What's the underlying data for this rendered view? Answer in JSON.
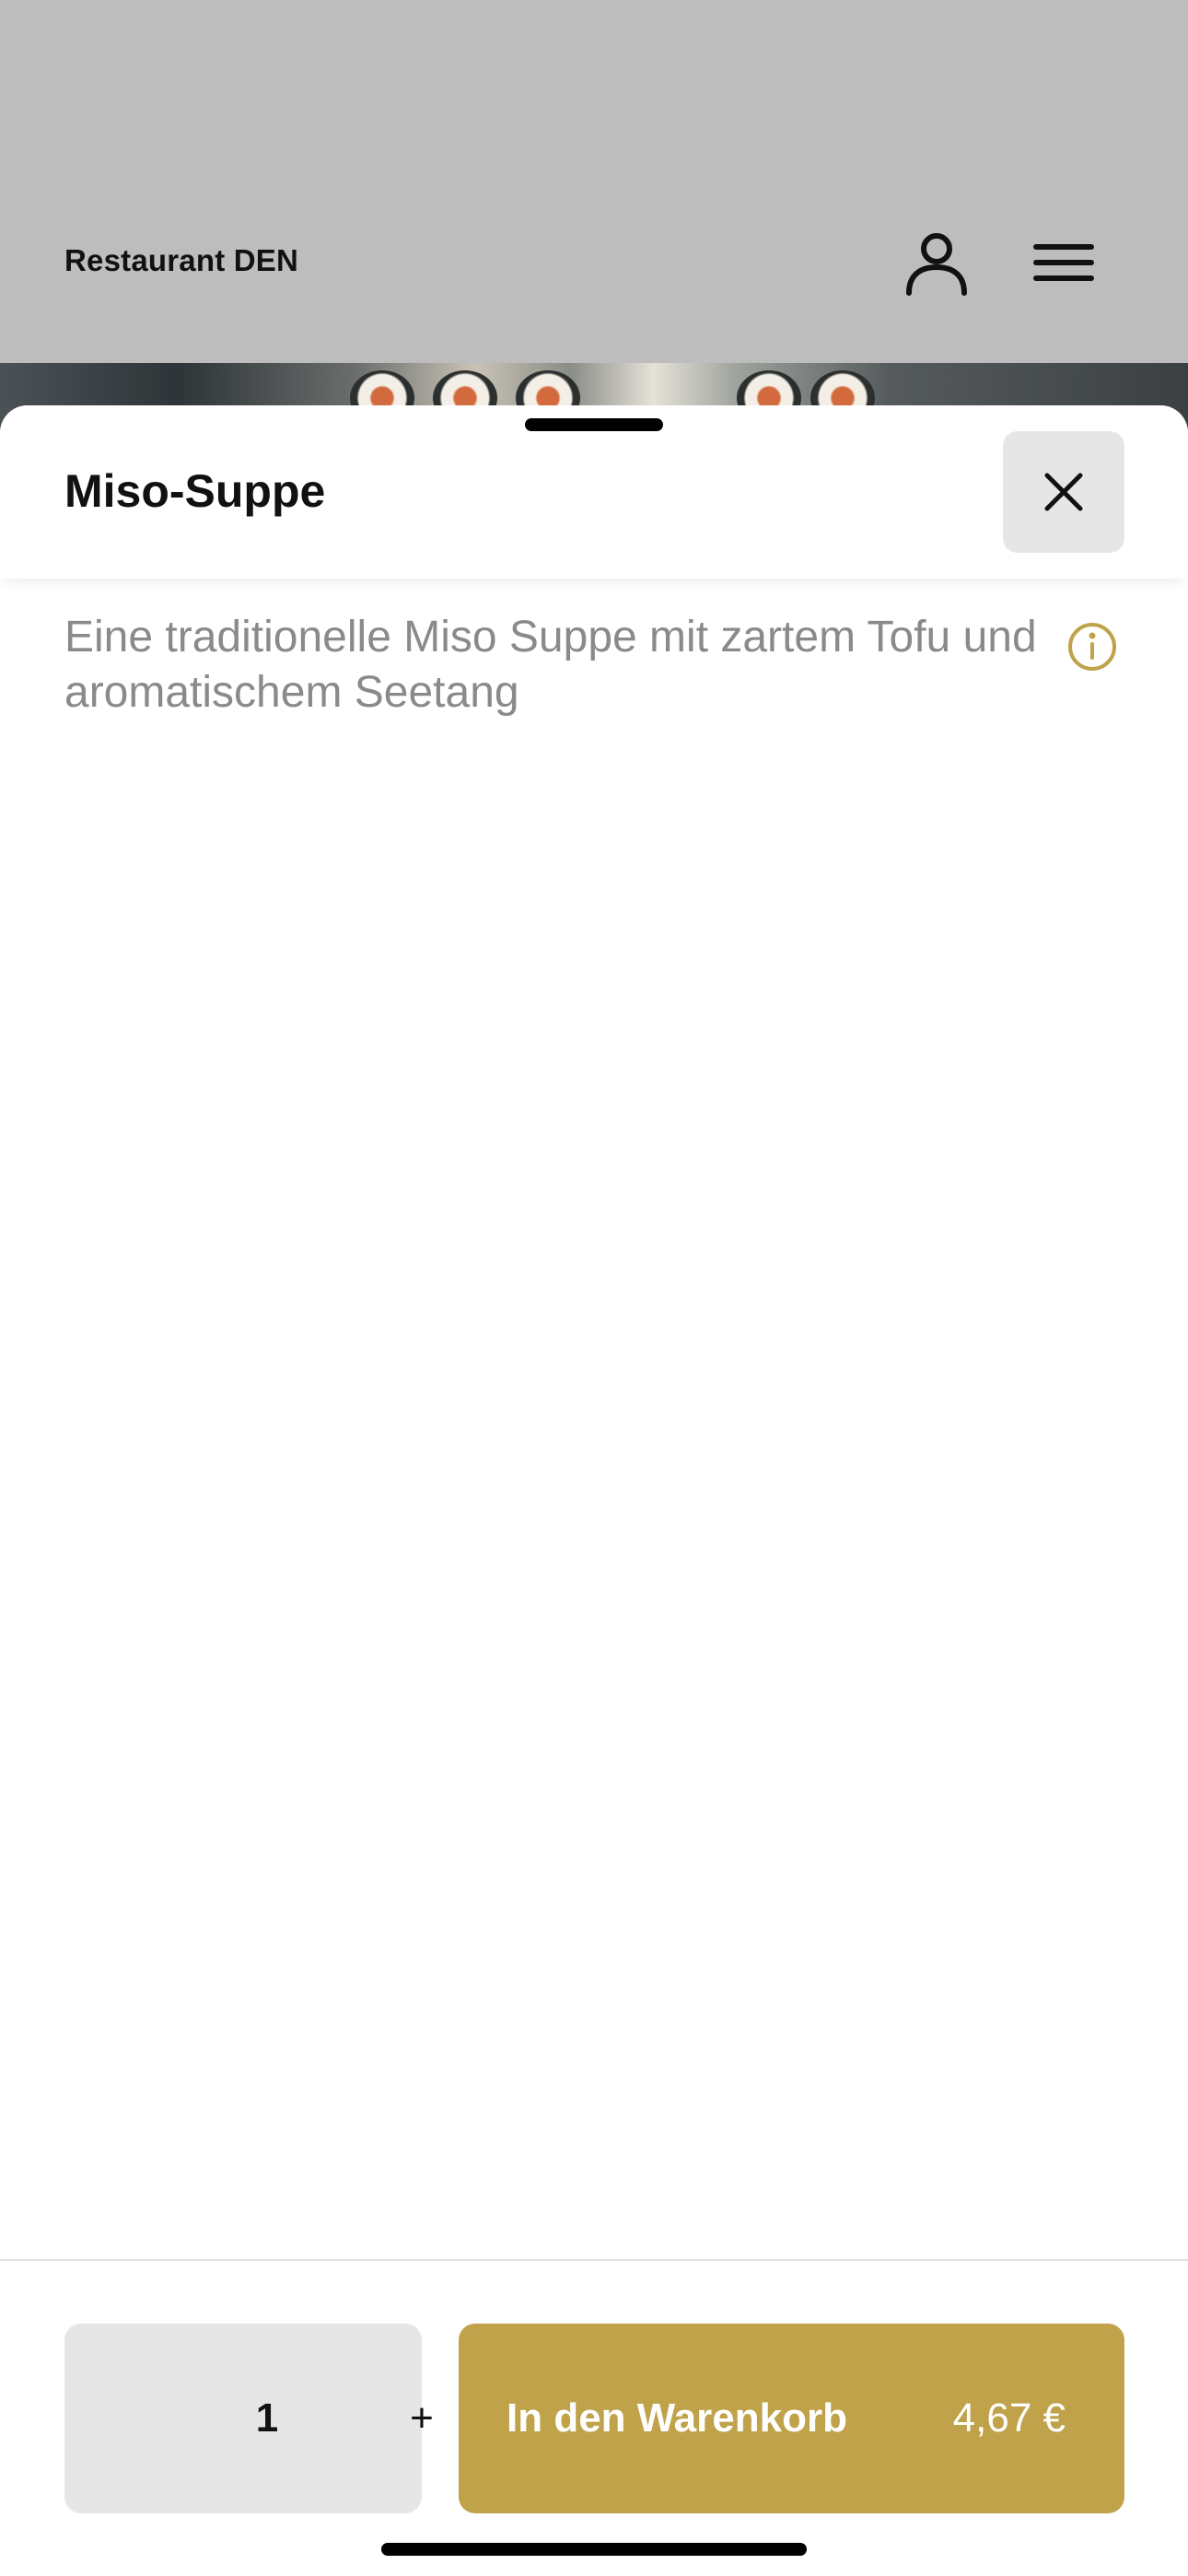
{
  "header": {
    "brand": "Restaurant DEN",
    "user_icon": "user-icon",
    "menu_icon": "hamburger-menu-icon"
  },
  "sheet": {
    "title": "Miso-Suppe",
    "close_icon": "close-icon",
    "description": "Eine traditionelle Miso Suppe mit zartem Tofu und aromatischem Seetang",
    "info_icon": "info-icon"
  },
  "order": {
    "quantity": "1",
    "plus_label": "+",
    "cart_label": "In den Warenkorb",
    "price": "4,67 €"
  },
  "colors": {
    "accent": "#c0a24a",
    "overlay_gray": "#bdbdbd",
    "button_gray": "#e6e6e6",
    "description_text": "#8a8a8a"
  }
}
